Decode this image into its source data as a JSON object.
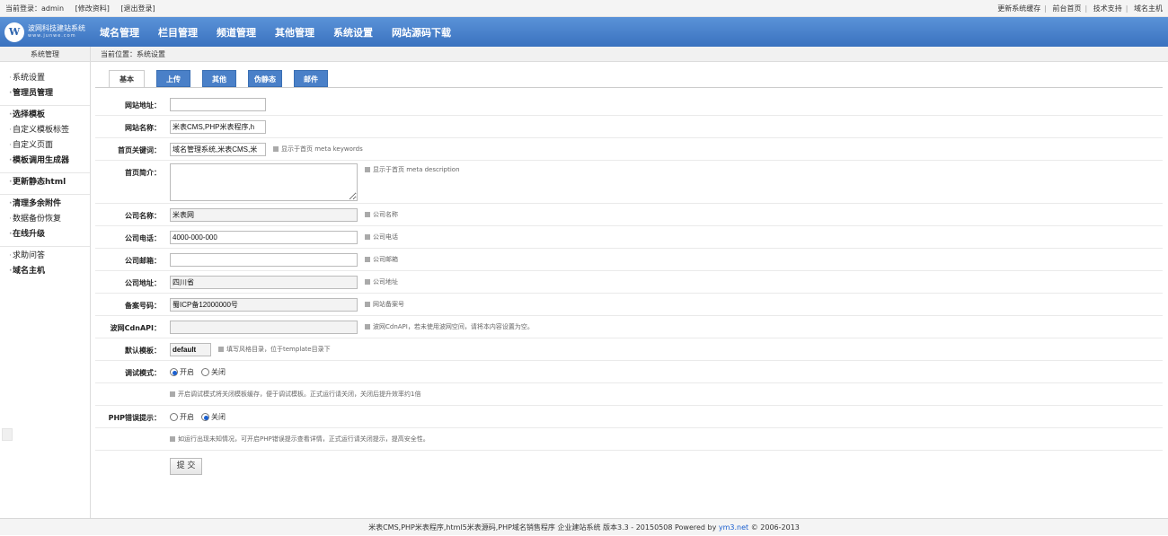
{
  "topbar": {
    "login_label": "当前登录：admin",
    "edit_profile": "[修改资料]",
    "logout": "[退出登录]",
    "links": [
      "更新系统缓存",
      "前台首页",
      "技术支持",
      "域名主机"
    ]
  },
  "nav": {
    "logo_line1": "波网科技建站系统",
    "logo_line2": "www.junwe.com",
    "logo_mark": "W",
    "items": [
      "域名管理",
      "栏目管理",
      "频道管理",
      "其他管理",
      "系统设置",
      "网站源码下载"
    ]
  },
  "subhead": {
    "sidebar_title": "系统管理",
    "breadcrumb": "当前位置：系统设置"
  },
  "sidebar": {
    "groups": [
      [
        "系统设置",
        "管理员管理"
      ],
      [
        "选择模板",
        "自定义模板标签",
        "自定义页面",
        "模板调用生成器"
      ],
      [
        "更新静态html"
      ],
      [
        "清理多余附件",
        "数据备份恢复",
        "在线升级"
      ],
      [
        "求助问答",
        "域名主机"
      ]
    ]
  },
  "tabs": [
    "基本",
    "上传",
    "其他",
    "伪静态",
    "邮件"
  ],
  "form": {
    "site_url": {
      "label": "网站地址：",
      "value": ""
    },
    "site_name": {
      "label": "网站名称：",
      "value": "米表CMS,PHP米表程序,h"
    },
    "keywords": {
      "label": "首页关键词：",
      "value": "域名管理系统,米表CMS,米",
      "hint": "显示于首页 meta keywords"
    },
    "description": {
      "label": "首页简介：",
      "value": "",
      "hint": "显示于首页 meta description"
    },
    "company": {
      "label": "公司名称：",
      "value": "米表网",
      "hint": "公司名称"
    },
    "phone": {
      "label": "公司电话：",
      "value": "4000-000-000",
      "hint": "公司电话"
    },
    "email": {
      "label": "公司邮箱：",
      "value": "",
      "hint": "公司邮箱"
    },
    "address": {
      "label": "公司地址：",
      "value": "四川省",
      "hint": "公司地址"
    },
    "icp": {
      "label": "备案号码：",
      "value": "蜀ICP备12000000号",
      "hint": "网站备案号"
    },
    "cdn": {
      "label": "波网CdnAPI：",
      "value": "",
      "hint": "波网CdnAPI，若未使用波网空间，请将本内容设置为空。"
    },
    "template": {
      "label": "默认模板：",
      "value": "default",
      "hint": "填写风格目录，位于template目录下"
    },
    "debug": {
      "label": "调试模式：",
      "on": "开启",
      "off": "关闭",
      "note": "开启调试模式将关闭模板缓存，便于调试模板。正式运行请关闭，关闭后提升效率约1倍"
    },
    "php_error": {
      "label": "PHP错误提示：",
      "on": "开启",
      "off": "关闭",
      "note": "如运行出现未知情况，可开启PHP错误提示查看详情，正式运行请关闭提示，提高安全性。"
    },
    "submit": "提 交"
  },
  "footer": {
    "text": "米表CMS,PHP米表程序,html5米表源码,PHP域名销售程序 企业建站系统 版本3.3 - 20150508 Powered by",
    "brand": "ym3.net",
    "copyright": "© 2006-2013"
  }
}
